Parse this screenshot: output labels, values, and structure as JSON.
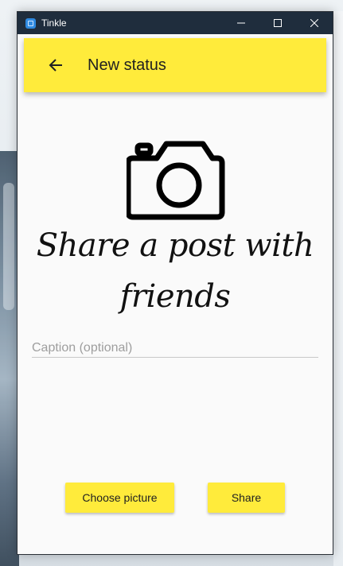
{
  "window": {
    "title": "Tinkle"
  },
  "appbar": {
    "title": "New status",
    "back_icon": "arrow-back-icon"
  },
  "hero": {
    "icon": "camera-icon",
    "headline": "Share a post with friends"
  },
  "caption": {
    "placeholder": "Caption (optional)",
    "value": ""
  },
  "actions": {
    "choose_label": "Choose picture",
    "share_label": "Share"
  },
  "colors": {
    "accent": "#ffeb3b",
    "titlebar": "#1f2d3d",
    "background": "#fafafa"
  }
}
